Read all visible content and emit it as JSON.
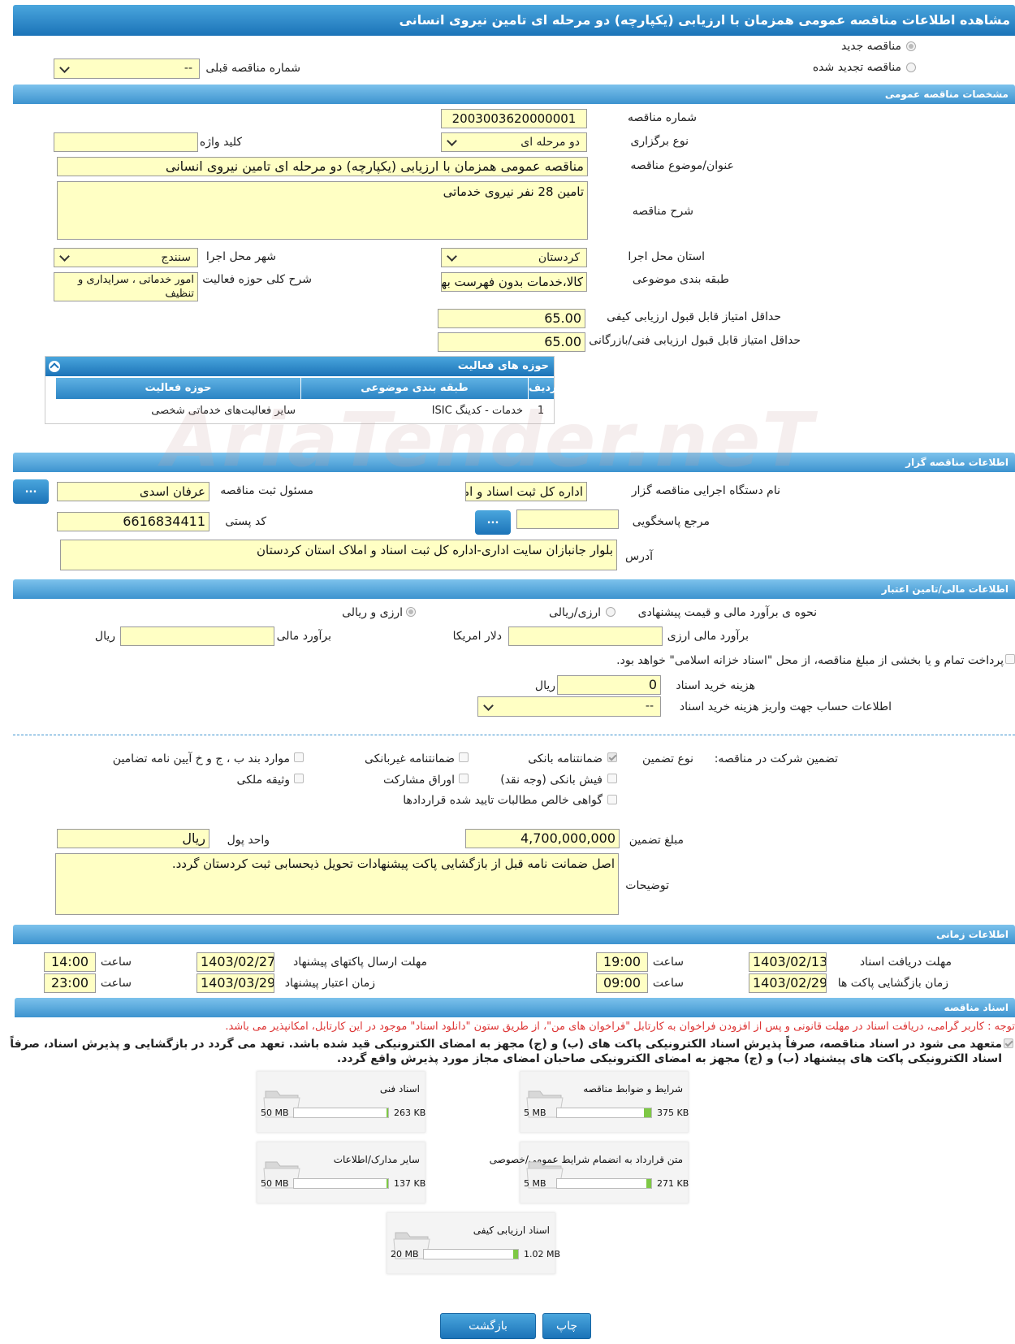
{
  "page": {
    "title": "مشاهده اطلاعات مناقصه عمومی همزمان با ارزیابی (یکپارچه) دو مرحله ای تامین نیروی انسانی"
  },
  "top": {
    "radio_new": "مناقصه جدید",
    "radio_renewed": "مناقصه تجدید شده",
    "prev_tender_label": "شماره مناقصه قبلی",
    "prev_tender_value": "--"
  },
  "general": {
    "section_title": "مشخصات مناقصه عمومی",
    "tender_no_label": "شماره مناقصه",
    "tender_no_value": "2003003620000001",
    "holding_type_label": "نوع برگزاری",
    "holding_type_value": "دو مرحله ای",
    "keyword_label": "کلید واژه",
    "keyword_value": "",
    "subject_label": "عنوان/موضوع مناقصه",
    "subject_value": "مناقصه عمومی همزمان با ارزیابی (یکپارچه) دو مرحله ای تامین نیروی انسانی",
    "description_label": "شرح مناقصه",
    "description_value": "تامین 28 نفر نیروی خدماتی",
    "province_label": "استان محل اجرا",
    "province_value": "کردستان",
    "city_label": "شهر محل اجرا",
    "city_value": "سنندج",
    "category_label": "طبقه بندی موضوعی",
    "category_value": "کالا،خدمات بدون فهرست بها",
    "activity_desc_label": "شرح کلی حوزه فعالیت",
    "activity_desc_value": "امور خدماتی ، سرایداری و تنظیف",
    "min_quality_label": "حداقل امتیاز قابل قبول ارزیابی کیفی",
    "min_quality_value": "65.00",
    "min_tech_label": "حداقل امتیاز قابل قبول ارزیابی فنی/بازرگانی",
    "min_tech_value": "65.00"
  },
  "activity_grid": {
    "title": "حوزه های فعالیت",
    "columns": [
      "ردیف",
      "طبقه بندی موضوعی",
      "حوزه فعالیت"
    ],
    "rows": [
      [
        "1",
        "خدمات - کدینگ ISIC",
        "سایر فعالیت‌های خدماتی شخصی"
      ]
    ]
  },
  "organizer": {
    "section_title": "اطلاعات مناقصه گزار",
    "org_name_label": "نام دستگاه اجرایی مناقصه گزار",
    "org_name_value": "اداره کل ثبت اسناد و املاک استان کردستان",
    "registrar_label": "مسئول ثبت مناقصه",
    "registrar_value": "عرفان اسدی",
    "dots_label": "...",
    "reference_label": "مرجع پاسخگویی",
    "reference_value": "",
    "postal_label": "کد پستی",
    "postal_value": "6616834411",
    "address_label": "آدرس",
    "address_value": "بلوار جانبازان سایت اداری-اداره کل ثبت اسناد و املاک استان کردستان"
  },
  "finance": {
    "section_title": "اطلاعات مالی/تامین اعتبار",
    "estimate_method_label": "نحوه ی برآورد مالی و قیمت پیشنهادی",
    "opt_currency_rial": "ارزی/ریالی",
    "opt_currency_and_rial": "ارزی و ریالی",
    "fx_estimate_label": "برآورد مالی ارزی",
    "fx_estimate_value": "",
    "usd_label": "دلار امریکا",
    "estimate_label": "برآورد مالی",
    "estimate_value": "",
    "rial_label": "ریال",
    "treasury_text": "پرداخت تمام و یا بخشی از مبلغ مناقصه، از محل \"اسناد خزانه اسلامی\" خواهد بود.",
    "doc_fee_label": "هزینه خرید اسناد",
    "doc_fee_value": "0",
    "doc_fee_unit": "ریال",
    "account_label": "اطلاعات حساب جهت واریز هزینه خرید اسناد",
    "account_value": "--"
  },
  "guarantee": {
    "title": "تضمین شرکت در مناقصه:",
    "type_label": "نوع تضمین",
    "opt_bank_guarantee": "ضمانتنامه بانکی",
    "opt_nonbank_guarantee": "ضمانتنامه غیربانکی",
    "opt_clauses": "موارد بند ب ، ج و خ آیین نامه تضامین",
    "opt_bank_receipt": "فیش بانکی (وجه نقد)",
    "opt_participation": "اوراق مشارکت",
    "opt_property": "وثیقه ملکی",
    "opt_receivables": "گواهی خالص مطالبات تایید شده قراردادها",
    "amount_label": "مبلغ تضمین",
    "amount_value": "4,700,000,000",
    "currency_label": "واحد پول",
    "currency_value": "ریال",
    "notes_label": "توضیحات",
    "notes_value": "اصل ضمانت نامه قبل از بازگشایی پاکت پیشنهادات تحویل ذیحسابی ثبت کردستان گردد."
  },
  "timing": {
    "section_title": "اطلاعات زمانی",
    "doc_deadline_label": "مهلت دریافت اسناد",
    "doc_deadline_date": "1403/02/13",
    "doc_deadline_time": "19:00",
    "send_deadline_label": "مهلت ارسال پاکتهای پیشنهاد",
    "send_deadline_date": "1403/02/27",
    "send_deadline_time": "14:00",
    "opening_label": "زمان بازگشایی پاکت ها",
    "opening_date": "1403/02/29",
    "opening_time": "09:00",
    "validity_label": "زمان اعتبار پیشنهاد",
    "validity_date": "1403/03/29",
    "validity_time": "23:00",
    "time_label": "ساعت"
  },
  "documents": {
    "section_title": "اسناد مناقصه",
    "notice": "توجه : کاربر گرامی، دریافت اسناد در مهلت قانونی و پس از افزودن فراخوان به کارتابل \"فراخوان های من\"، از طریق ستون \"دانلود اسناد\" موجود در این کارتابل، امکانپذیر می باشد.",
    "commitment": "متعهد می شود در اسناد مناقصه، صرفاً پذیرش اسناد الکترونیکی پاکت های (ب) و (ج) مجهز به امضای الکترونیکی قید شده باشد. تعهد می گردد در بازگشایی و پذیرش اسناد، صرفاً اسناد الکترونیکی پاکت های پیشنهاد (ب) و (ج) مجهز به امضای الکترونیکی صاحبان امضای مجاز مورد پذیرش واقع گردد.",
    "files": [
      {
        "title": "شرایط و ضوابط مناقصه",
        "current": "375 KB",
        "max": "5 MB",
        "fill": 0.075
      },
      {
        "title": "اسناد فنی",
        "current": "263 KB",
        "max": "50 MB",
        "fill": 0.005
      },
      {
        "title": "متن قرارداد به انضمام شرایط عمومی/خصوصی",
        "current": "271 KB",
        "max": "5 MB",
        "fill": 0.054
      },
      {
        "title": "سایر مدارک/اطلاعات",
        "current": "137 KB",
        "max": "50 MB",
        "fill": 0.003
      },
      {
        "title": "اسناد ارزیابی کیفی",
        "current": "1.02 MB",
        "max": "20 MB",
        "fill": 0.051
      }
    ]
  },
  "footer": {
    "back_label": "بازگشت",
    "print_label": "چاپ"
  },
  "watermark": "AriaTender.neT"
}
